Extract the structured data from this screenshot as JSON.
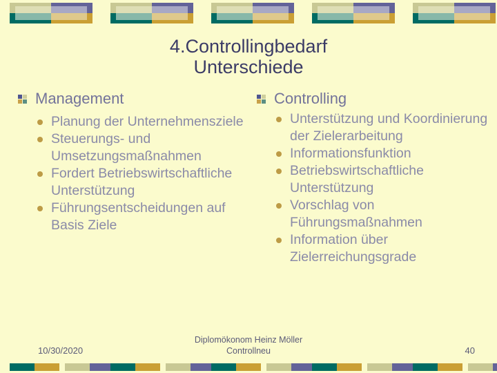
{
  "slide": {
    "title_lines": [
      "4.Controllingbedarf",
      "Unterschiede"
    ],
    "background_color": "#fbfbcd",
    "title_color": "#3b3b66",
    "heading_color": "#73739a",
    "body_color": "#8a8aa8",
    "bullet_color": "#bd9b46"
  },
  "columns": {
    "left": {
      "heading": "Management",
      "heading_bullet_icon": "quad-square-bullet-icon",
      "items": [
        "Planung der Unternehmensziele",
        "Steuerungs- und Umsetzungsmaßnahmen",
        "Fordert Betriebswirtschaftliche Unterstützung",
        "Führungsentscheidungen auf Basis Ziele"
      ]
    },
    "right": {
      "heading": "Controlling",
      "heading_bullet_icon": "quad-square-bullet-icon",
      "items": [
        "Unterstützung und Koordinierung der Zielerarbeitung",
        "Informationsfunktion",
        "Betriebswirtschaftliche Unterstützung",
        "Vorschlag von Führungsmaßnahmen",
        "Information über Zielerreichungsgrade"
      ]
    }
  },
  "footer": {
    "date": "10/30/2020",
    "center_line1": "Diplomökonom Heinz Möller",
    "center_line2": "Controllneu",
    "page_number": "40"
  },
  "decoration": {
    "top_band_tiles": 5,
    "bottom_band_tiles": 5,
    "colors": {
      "teal": "#006b63",
      "gold": "#ca9f34",
      "sage": "#c8c894",
      "purple": "#636399"
    }
  }
}
